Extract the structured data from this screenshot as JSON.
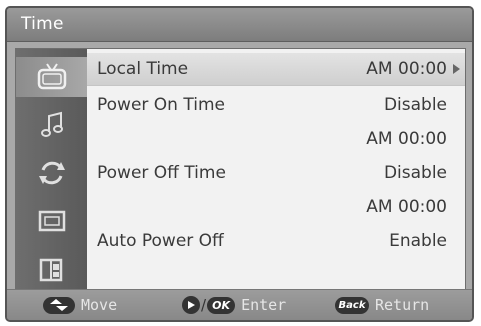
{
  "title": "Time",
  "sidebar": {
    "icons": [
      "tv-picture-icon",
      "music-note-icon",
      "refresh-icon",
      "screen-icon",
      "gift-icon"
    ],
    "active_index": 0
  },
  "rows": [
    {
      "label": "Local Time",
      "value": "AM 00:00",
      "selected": true
    },
    {
      "label": "Power On Time",
      "value": "Disable"
    },
    {
      "label": "",
      "value": "AM 00:00"
    },
    {
      "label": "Power Off Time",
      "value": "Disable"
    },
    {
      "label": "",
      "value": "AM 00:00"
    },
    {
      "label": "Auto Power Off",
      "value": "Enable"
    }
  ],
  "footer": {
    "move": "Move",
    "ok_badge": "OK",
    "enter": "Enter",
    "back_badge": "Back",
    "return": "Return"
  }
}
